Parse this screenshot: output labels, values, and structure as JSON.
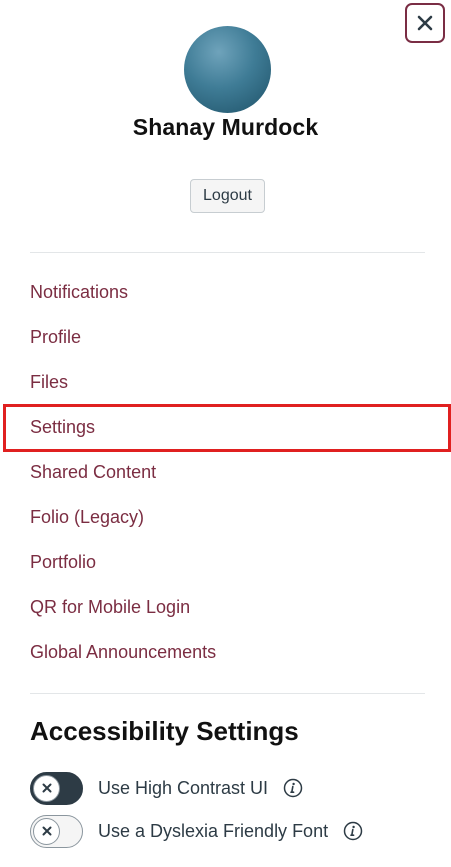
{
  "user": {
    "name": "Shanay Murdock"
  },
  "actions": {
    "logout_label": "Logout"
  },
  "nav": {
    "items": [
      {
        "label": "Notifications"
      },
      {
        "label": "Profile"
      },
      {
        "label": "Files"
      },
      {
        "label": "Settings"
      },
      {
        "label": "Shared Content"
      },
      {
        "label": "Folio (Legacy)"
      },
      {
        "label": "Portfolio"
      },
      {
        "label": "QR for Mobile Login"
      },
      {
        "label": "Global Announcements"
      }
    ],
    "highlighted": "Settings"
  },
  "accessibility": {
    "heading": "Accessibility Settings",
    "toggles": [
      {
        "label": "Use High Contrast UI",
        "checked": false
      },
      {
        "label": "Use a Dyslexia Friendly Font",
        "checked": false
      }
    ]
  },
  "colors": {
    "link": "#7b2d42",
    "close_border": "#7a2d44",
    "highlight_border": "#e02020",
    "dark_toggle": "#2d3b45"
  },
  "icons": {
    "close": "close-icon",
    "info": "info-icon",
    "toggle_knob": "x-icon"
  }
}
